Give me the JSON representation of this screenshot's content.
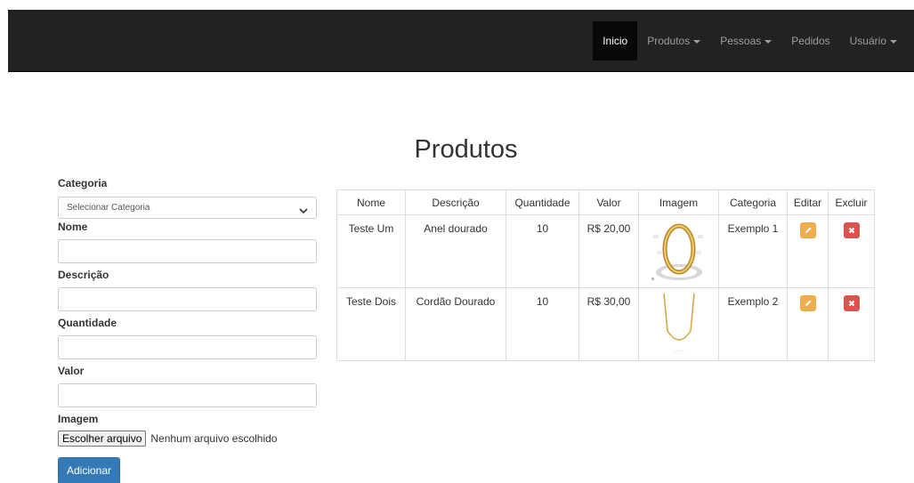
{
  "nav": {
    "items": [
      {
        "label": "Inicio",
        "active": true,
        "dropdown": false
      },
      {
        "label": "Produtos",
        "active": false,
        "dropdown": true
      },
      {
        "label": "Pessoas",
        "active": false,
        "dropdown": true
      },
      {
        "label": "Pedidos",
        "active": false,
        "dropdown": false
      },
      {
        "label": "Usuário",
        "active": false,
        "dropdown": true
      }
    ]
  },
  "page": {
    "title": "Produtos"
  },
  "form": {
    "category_label": "Categoria",
    "category_selected": "Selecionar Categoria",
    "name_label": "Nome",
    "description_label": "Descrição",
    "quantity_label": "Quantidade",
    "value_label": "Valor",
    "image_label": "Imagem",
    "file_button": "Escolher arquivo",
    "file_status": "Nenhum arquivo escolhido",
    "submit_label": "Adicionar"
  },
  "table": {
    "headers": [
      "Nome",
      "Descrição",
      "Quantidade",
      "Valor",
      "Imagem",
      "Categoria",
      "Editar",
      "Excluir"
    ],
    "rows": [
      {
        "name": "Teste Um",
        "description": "Anel dourado",
        "quantity": "10",
        "value": "R$ 20,00",
        "image": "gold-ring-image",
        "category": "Exemplo 1"
      },
      {
        "name": "Teste Dois",
        "description": "Cordão Dourado",
        "quantity": "10",
        "value": "R$ 30,00",
        "image": "gold-chain-image",
        "category": "Exemplo 2"
      }
    ]
  },
  "colors": {
    "navbar": "#222222",
    "primary": "#337ab7",
    "warning": "#f0ad4e",
    "danger": "#d9534f"
  }
}
